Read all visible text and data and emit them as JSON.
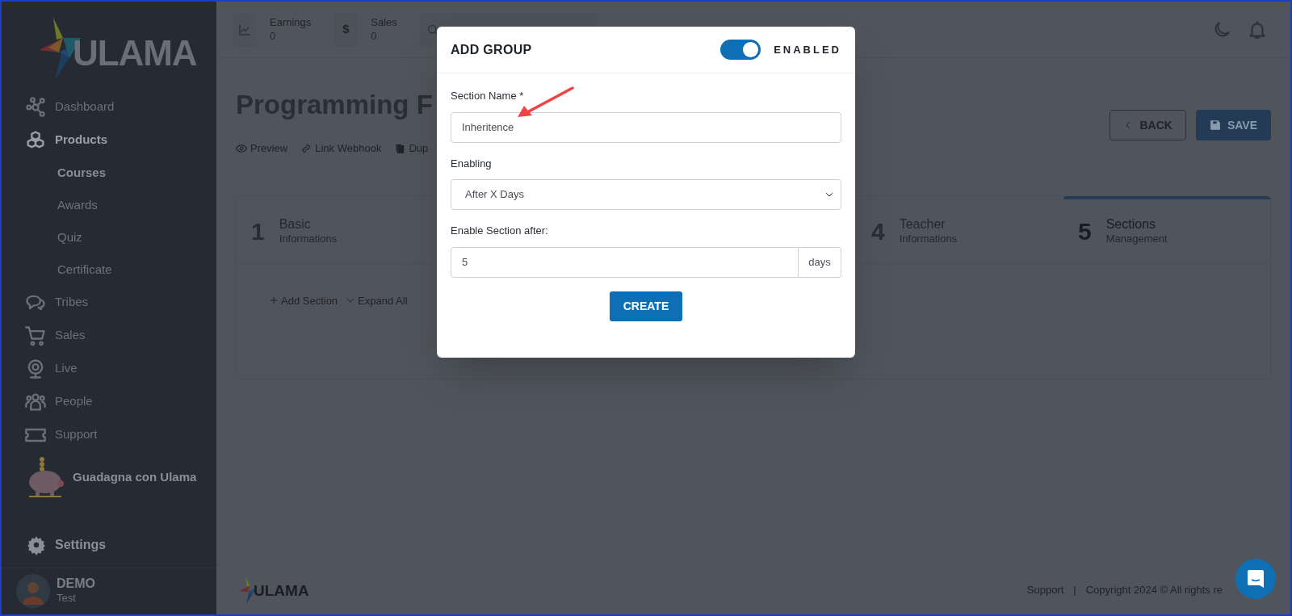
{
  "topbar": {
    "stats": [
      {
        "kind": "chart",
        "label": "Earnings",
        "value": "0"
      },
      {
        "kind": "dollar",
        "symbol": "$",
        "label": "Sales",
        "value": "0"
      }
    ]
  },
  "sidebar": {
    "logo": "ULAMA",
    "items": [
      {
        "label": "Dashboard",
        "selected": false
      },
      {
        "label": "Products",
        "selected": true,
        "children": [
          {
            "label": "Courses",
            "selected": true
          },
          {
            "label": "Awards",
            "selected": false
          },
          {
            "label": "Quiz",
            "selected": false
          },
          {
            "label": "Certificate",
            "selected": false
          }
        ]
      },
      {
        "label": "Tribes",
        "selected": false
      },
      {
        "label": "Sales",
        "selected": false
      },
      {
        "label": "Live",
        "selected": false
      },
      {
        "label": "People",
        "selected": false
      },
      {
        "label": "Support",
        "selected": false
      }
    ],
    "promo": "Guadagna con Ulama",
    "settings": "Settings",
    "user": {
      "name": "DEMO",
      "role": "Test"
    }
  },
  "page": {
    "title": "Programming F",
    "links": [
      {
        "kind": "eye",
        "label": "Preview"
      },
      {
        "kind": "link",
        "label": "Link Webhook"
      },
      {
        "kind": "copy",
        "label": "Dup"
      }
    ],
    "buttons": [
      {
        "kind": "back",
        "label": "BACK"
      },
      {
        "kind": "save",
        "label": "SAVE"
      }
    ],
    "steps": [
      {
        "number": "1",
        "title": "Basic",
        "subtitle": "Informations",
        "selected": false
      },
      {
        "number": "4",
        "title": "Teacher",
        "subtitle": "Informations",
        "selected": false
      },
      {
        "number": "5",
        "title": "Sections",
        "subtitle": "Management",
        "selected": true
      }
    ],
    "toolbar": [
      {
        "kind": "plus",
        "label": "Add Section"
      },
      {
        "kind": "chevron",
        "label": "Expand All"
      }
    ]
  },
  "footer": {
    "logo": "ULAMA",
    "support": "Support",
    "separator": "|",
    "copyright": "Copyright 2024 © All rights re"
  },
  "modal": {
    "title": "ADD GROUP",
    "toggle": {
      "on": true,
      "label": "ENABLED"
    },
    "fields": [
      {
        "kind": "text",
        "label": "Section Name *",
        "value": "Inheritence"
      },
      {
        "kind": "select",
        "label": "Enabling",
        "value": "After X Days"
      },
      {
        "kind": "addon",
        "label": "Enable Section after:",
        "value": "5",
        "addon": "days"
      }
    ],
    "button": "CREATE"
  }
}
